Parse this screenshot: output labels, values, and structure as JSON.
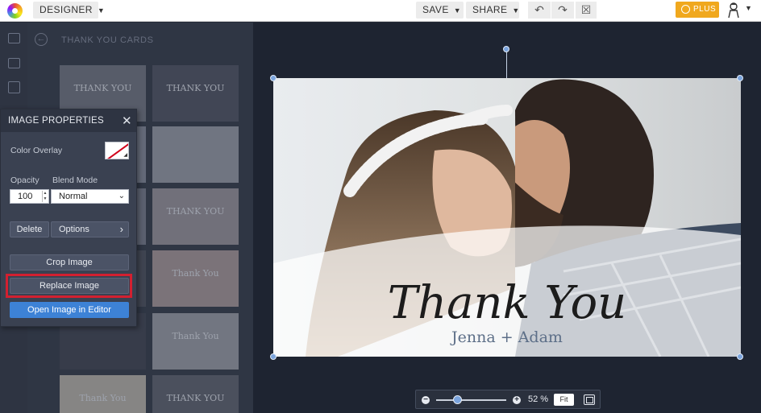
{
  "app": {
    "mode_label": "DESIGNER",
    "save_label": "SAVE",
    "share_label": "SHARE",
    "plus_label": "PLUS",
    "icons": {
      "logo": "rainbow-logo-icon",
      "undo": "undo-icon",
      "redo": "redo-icon",
      "close": "close-box-icon",
      "avatar": "user-avatar-icon"
    }
  },
  "library": {
    "title": "THANK YOU CARDS",
    "thumbnails": [
      {
        "label": "THANK YOU"
      },
      {
        "label": "THANK YOU"
      },
      {
        "label": ""
      },
      {
        "label": ""
      },
      {
        "label": ""
      },
      {
        "label": "THANK YOU"
      },
      {
        "label": ""
      },
      {
        "label": "Thank You"
      },
      {
        "label": ""
      },
      {
        "label": "Thank You"
      },
      {
        "label": "Thank You"
      },
      {
        "label": "THANK YOU"
      }
    ]
  },
  "image_properties": {
    "title": "IMAGE PROPERTIES",
    "color_overlay_label": "Color Overlay",
    "opacity_label": "Opacity",
    "opacity_value": "100",
    "blend_mode_label": "Blend Mode",
    "blend_mode_value": "Normal",
    "delete_label": "Delete",
    "options_label": "Options",
    "crop_label": "Crop Image",
    "replace_label": "Replace Image",
    "open_editor_label": "Open Image in Editor"
  },
  "card": {
    "headline": "Thank You",
    "names": "Jenna + Adam"
  },
  "zoom": {
    "percent_label": "52 %",
    "fit_label": "Fit",
    "level": 0.52
  },
  "colors": {
    "accent_blue": "#3d82d6",
    "plus_orange": "#f0a81e",
    "highlight_red": "#d32030",
    "panel_dark": "#3a4151"
  }
}
